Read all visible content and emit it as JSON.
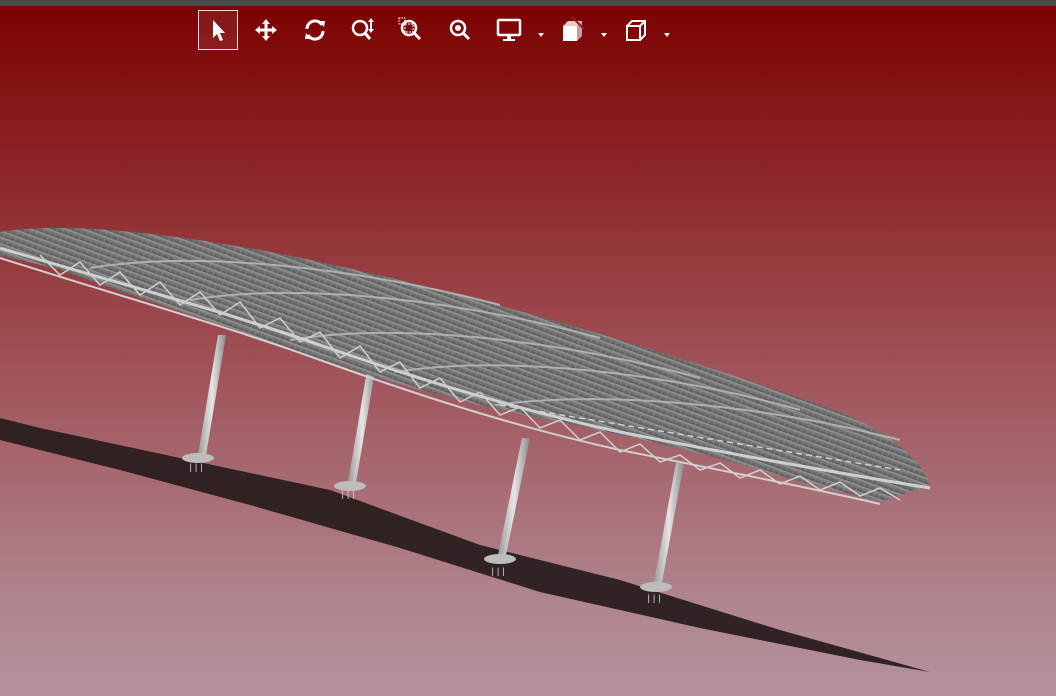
{
  "app": {
    "view": "3d-model-viewer",
    "background_top": "#7c0000",
    "background_bottom": "#b4929a"
  },
  "toolbar": {
    "tools": [
      {
        "name": "select",
        "icon": "cursor-arrow-icon",
        "active": true
      },
      {
        "name": "pan",
        "icon": "move-arrows-icon",
        "active": false
      },
      {
        "name": "rotate",
        "icon": "rotate-icon",
        "active": false
      },
      {
        "name": "zoom",
        "icon": "zoom-vertical-icon",
        "active": false
      },
      {
        "name": "zoom-window",
        "icon": "zoom-window-icon",
        "active": false
      },
      {
        "name": "zoom-fit",
        "icon": "zoom-fit-icon",
        "active": false
      },
      {
        "name": "display-mode",
        "icon": "monitor-icon",
        "has_dropdown": true
      },
      {
        "name": "section",
        "icon": "section-cube-icon",
        "has_dropdown": true
      },
      {
        "name": "view-orientation",
        "icon": "cube-view-icon",
        "has_dropdown": true
      }
    ]
  },
  "model": {
    "description_visible": false,
    "structure_color": "#c8c8c8",
    "roof_color": "#808080",
    "shadow_color": "#2a1d1e",
    "column_count": 4
  }
}
